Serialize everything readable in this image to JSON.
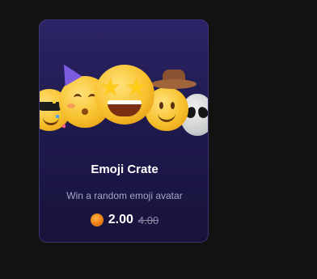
{
  "card": {
    "title": "Emoji Crate",
    "description": "Win a random emoji avatar",
    "price": "2.00",
    "original_price": "4.00",
    "currency_icon": "coin-icon",
    "preview_emojis": [
      "sunglasses-face",
      "partying-face",
      "star-struck-face",
      "cowboy-face",
      "alien"
    ]
  },
  "colors": {
    "page_background": "#121212",
    "card_gradient_top": "#2c2467",
    "card_gradient_bottom": "#17133b",
    "card_border": "#3a3470",
    "coin": "#f07a12"
  }
}
